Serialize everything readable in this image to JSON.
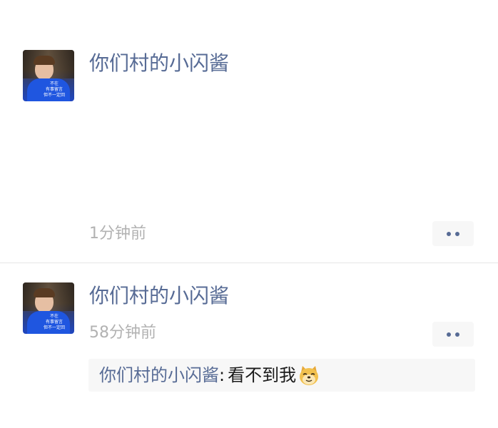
{
  "posts": [
    {
      "author": "你们村的小闪酱",
      "avatar_caption": [
        "不在",
        "有事留言",
        "但不一定回"
      ],
      "time": "1分钟前",
      "more_icon": "ellipsis-icon"
    },
    {
      "author": "你们村的小闪酱",
      "avatar_caption": [
        "不在",
        "有事留言",
        "但不一定回"
      ],
      "time": "58分钟前",
      "more_icon": "ellipsis-icon",
      "comment": {
        "author": "你们村的小闪酱",
        "separator": ":",
        "text": "看不到我",
        "emoji": "doge-emoji-icon"
      }
    }
  ],
  "colors": {
    "name": "#576b95",
    "time": "#b2b2b2",
    "comment_bg": "#f7f7f7"
  }
}
